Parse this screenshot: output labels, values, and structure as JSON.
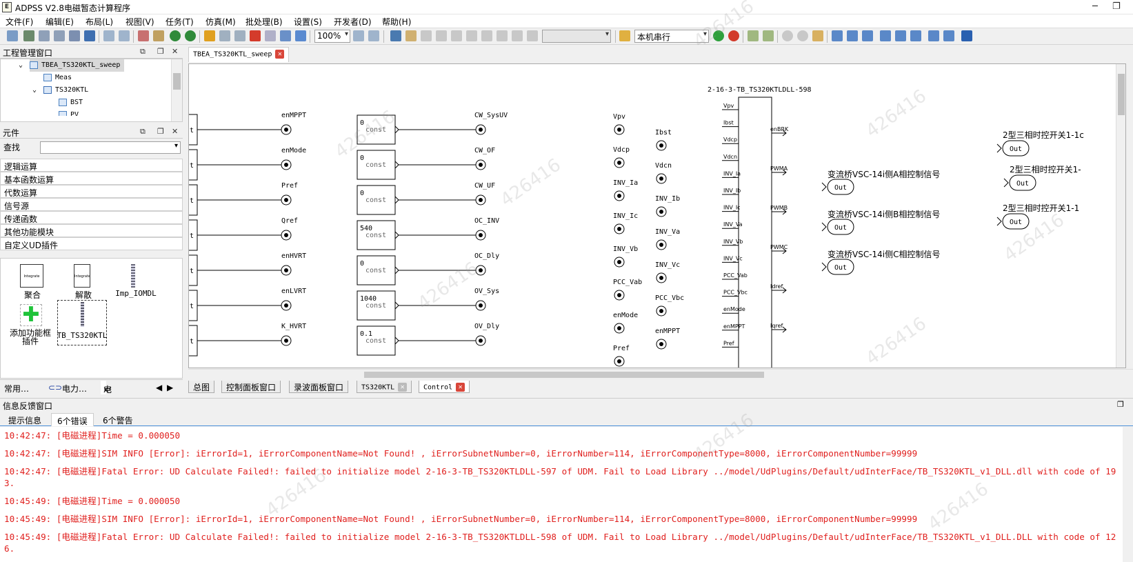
{
  "window": {
    "title": "ADPSS V2.8电磁暂态计算程序",
    "app_icon_letter": "E"
  },
  "menu": [
    "文件(F)",
    "编辑(E)",
    "布局(L)",
    "视图(V)",
    "任务(T)",
    "仿真(M)",
    "批处理(B)",
    "设置(S)",
    "开发者(D)",
    "帮助(H)"
  ],
  "toolbar": {
    "zoom": "100%",
    "run_mode": "本机串行"
  },
  "project_pane": {
    "title": "工程管理窗口",
    "tree": [
      {
        "label": "TBEA_TS320KTL_sweep",
        "level": 0,
        "expanded": true,
        "selected": true
      },
      {
        "label": "Meas",
        "level": 1
      },
      {
        "label": "TS320KTL",
        "level": 1,
        "expanded": true
      },
      {
        "label": "BST",
        "level": 2
      },
      {
        "label": "PV",
        "level": 2
      }
    ]
  },
  "component_pane": {
    "title": "元件",
    "search_label": "查找",
    "search_value": "",
    "categories": [
      "逻辑运算",
      "基本函数运算",
      "代数运算",
      "信号源",
      "传递函数",
      "其他功能模块",
      "自定义UD插件"
    ],
    "items": [
      {
        "label": "聚合",
        "icon_text": "Integrate"
      },
      {
        "label": "解散",
        "icon_text": "Integrate"
      },
      {
        "label": "Imp_IOMDL"
      },
      {
        "label_line1": "添加功能框",
        "label_line2": "插件"
      },
      {
        "label": "TB_TS320KTL"
      }
    ],
    "bottom_tabs": [
      "常用…",
      "电力…",
      "电子…"
    ],
    "bottom_tab_prefix": "x²"
  },
  "editor": {
    "doc_tab": "TBEA_TS320KTL_sweep",
    "sheet_tabs": [
      "总图",
      "控制面板窗口",
      "录波面板窗口",
      "TS320KTL",
      "Control"
    ]
  },
  "diagram": {
    "inputs_col1": [
      "enMPPT",
      "enMode",
      "Pref",
      "Qref",
      "enHVRT",
      "enLVRT",
      "K_HVRT"
    ],
    "const_blocks": [
      {
        "value": "0",
        "label": "const",
        "out": "CW_SysUV"
      },
      {
        "value": "0",
        "label": "const",
        "out": "CW_OF"
      },
      {
        "value": "0",
        "label": "const",
        "out": "CW_UF"
      },
      {
        "value": "540",
        "label": "const",
        "out": "OC_INV"
      },
      {
        "value": "0",
        "label": "const",
        "out": "OC_Dly"
      },
      {
        "value": "1040",
        "label": "const",
        "out": "OV_Sys"
      },
      {
        "value": "0.1",
        "label": "const",
        "out": "OV_Dly"
      }
    ],
    "left_stub_text": "t",
    "meas_col_a": [
      "Vpv",
      "Vdcp",
      "INV_Ia",
      "INV_Ic",
      "INV_Vb",
      "PCC_Vab",
      "enMode",
      "Pref"
    ],
    "meas_col_b": [
      "Ibst",
      "Vdcn",
      "INV_Ib",
      "INV_Va",
      "INV_Vc",
      "PCC_Vbc",
      "enMPPT"
    ],
    "dll": {
      "title": "2-16-3-TB_TS320KTLDLL-598",
      "inputs": [
        "Vpv",
        "Ibst",
        "Vdcp",
        "Vdcn",
        "INV_Ia",
        "INV_Ib",
        "INV_Ic",
        "INV_Va",
        "INV_Vb",
        "INV_Vc",
        "PCC_Vab",
        "PCC_Vbc",
        "enMode",
        "enMPPT",
        "Pref"
      ],
      "outputs": [
        "enBRK",
        "PWMA",
        "PWMB",
        "PWMC",
        "Idref",
        "Iqref"
      ]
    },
    "out_ports": [
      {
        "label": "变流桥VSC-14i侧A相控制信号",
        "text": "Out"
      },
      {
        "label": "变流桥VSC-14i侧B相控制信号",
        "text": "Out"
      },
      {
        "label": "变流桥VSC-14i侧C相控制信号",
        "text": "Out"
      }
    ],
    "right_ports": [
      {
        "label": "2型三相时控开关1-1c",
        "text": "Out"
      },
      {
        "label": "2型三相时控开关1-",
        "text": "Out"
      },
      {
        "label": "2型三相时控开关1-1",
        "text": "Out"
      }
    ]
  },
  "info_pane": {
    "title": "信息反馈窗口",
    "tabs": [
      "提示信息",
      "6个错误",
      "6个警告"
    ],
    "active_tab": 1,
    "log": [
      "10:42:47: [电磁进程]Time = 0.000050",
      "10:42:47: [电磁进程]SIM INFO [Error]: iErrorId=1, iErrorComponentName=Not Found! , iErrorSubnetNumber=0, iErrorNumber=114, iErrorComponentType=8000, iErrorComponentNumber=99999",
      "10:42:47: [电磁进程]Fatal Error: UD Calculate Failed!: failed to initialize model 2-16-3-TB_TS320KTLDLL-597 of UDM. Fail to Load Library ../model/UdPlugins/Default/udInterFace/TB_TS320KTL_v1_DLL.dll with code of 193.",
      "10:45:49: [电磁进程]Time = 0.000050",
      "10:45:49: [电磁进程]SIM INFO [Error]: iErrorId=1, iErrorComponentName=Not Found! , iErrorSubnetNumber=0, iErrorNumber=114, iErrorComponentType=8000, iErrorComponentNumber=99999",
      "10:45:49: [电磁进程]Fatal Error: UD Calculate Failed!: failed to initialize model 2-16-3-TB_TS320KTLDLL-598 of UDM. Fail to Load Library ../model/UdPlugins/Default/udInterFace/TB_TS320KTL_v1_DLL.DLL with code of 126."
    ]
  },
  "watermark": "426416",
  "colors": {
    "error_text": "#e0201e",
    "accent": "#4a90d9"
  }
}
